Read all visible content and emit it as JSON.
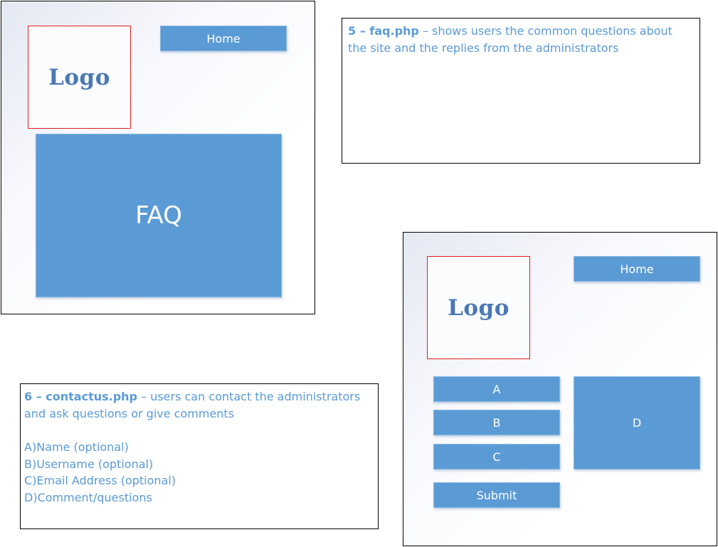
{
  "faq_mockup": {
    "logo": "Logo",
    "home_button": "Home",
    "faq_block": "FAQ"
  },
  "faq_description": {
    "title": "5 – faq.php",
    "separator": " – ",
    "text": "shows users the common questions about the site and the replies from the administrators"
  },
  "contact_mockup": {
    "logo": "Logo",
    "home_button": "Home",
    "field_a": "A",
    "field_b": "B",
    "field_c": "C",
    "field_d": "D",
    "submit_button": "Submit"
  },
  "contact_description": {
    "title": "6 – contactus.php",
    "separator": " – ",
    "text": "users can contact the administrators and ask questions or give comments",
    "fields": [
      "A)Name (optional)",
      "B)Username (optional)",
      "C)Email Address (optional)",
      "D)Comment/questions"
    ]
  },
  "colors": {
    "accent_blue": "#5b9bd5",
    "logo_border_red": "#e02020",
    "logo_text_blue": "#4a78b4"
  }
}
